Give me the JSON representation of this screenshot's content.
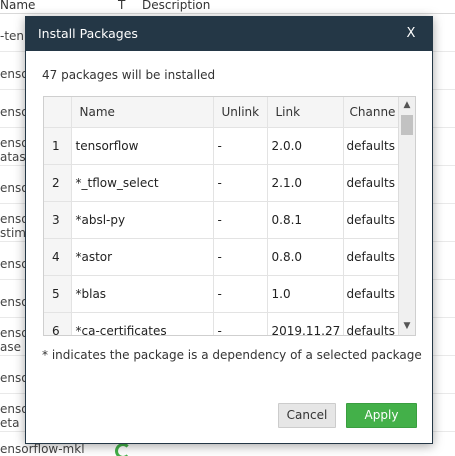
{
  "background": {
    "header": {
      "name": "Name",
      "type": "T",
      "description": "Description"
    },
    "rows": [
      "-ten",
      "enso",
      "enso",
      "enso\natas",
      "enso",
      "enso\nstim",
      "enso",
      "enso",
      "enso\nase",
      "enso",
      "enso\neta"
    ],
    "footer_row": "ensorflow-mkl"
  },
  "dialog": {
    "title": "Install Packages",
    "close_label": "X",
    "summary": "47 packages will be installed",
    "columns": [
      "Name",
      "Unlink",
      "Link",
      "Channe"
    ],
    "rows": [
      {
        "index": "1",
        "name": "tensorflow",
        "unlink": "-",
        "link": "2.0.0",
        "channel": "defaults"
      },
      {
        "index": "2",
        "name": "*_tflow_select",
        "unlink": "-",
        "link": "2.1.0",
        "channel": "defaults"
      },
      {
        "index": "3",
        "name": "*absl-py",
        "unlink": "-",
        "link": "0.8.1",
        "channel": "defaults"
      },
      {
        "index": "4",
        "name": "*astor",
        "unlink": "-",
        "link": "0.8.0",
        "channel": "defaults"
      },
      {
        "index": "5",
        "name": "*blas",
        "unlink": "-",
        "link": "1.0",
        "channel": "defaults"
      },
      {
        "index": "6",
        "name": "*ca-certificates",
        "unlink": "-",
        "link": "2019.11.27",
        "channel": "defaults"
      }
    ],
    "footnote": "* indicates the package is a dependency of a selected package",
    "cancel_label": "Cancel",
    "apply_label": "Apply"
  },
  "colors": {
    "titlebar": "#243746",
    "apply": "#43b049",
    "cancel": "#e6e6e6"
  },
  "icons": {
    "scroll_up": "chevron-up-icon",
    "scroll_down": "chevron-down-icon",
    "spinner": "loading-spinner-icon"
  }
}
